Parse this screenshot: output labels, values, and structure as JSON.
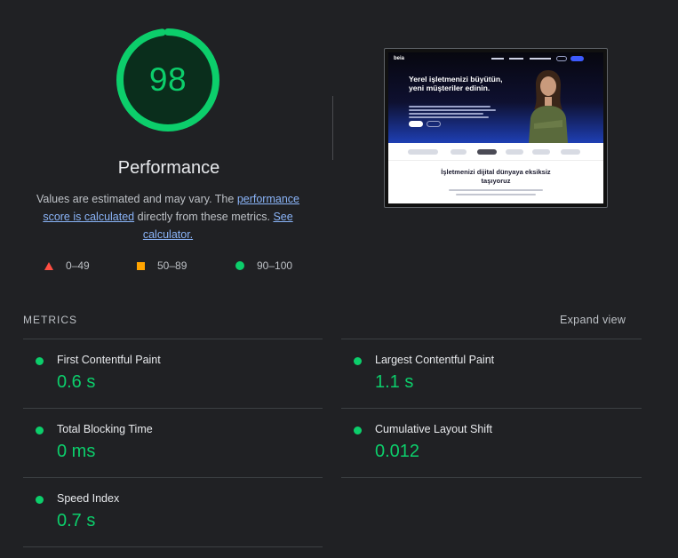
{
  "score": {
    "value": "98",
    "fraction": 0.98,
    "color": "#0cce6b"
  },
  "category_title": "Performance",
  "description": {
    "prefix": "Values are estimated and may vary. The ",
    "link1": "performance score is calculated",
    "middle": " directly from these metrics. ",
    "link2": "See calculator."
  },
  "legend": [
    {
      "icon": "fail-triangle-icon",
      "label": "0–49",
      "color": "#ff4e42"
    },
    {
      "icon": "average-square-icon",
      "label": "50–89",
      "color": "#ffa400"
    },
    {
      "icon": "pass-circle-icon",
      "label": "90–100",
      "color": "#0cce6b"
    }
  ],
  "screenshot": {
    "nav_logo": "beia",
    "hero_title": "Yerel işletmenizi büyütün, yeni müşteriler edinin.",
    "section_title": "İşletmenizi dijital dünyaya eksiksiz taşıyoruz"
  },
  "metrics": {
    "header": "METRICS",
    "expand_label": "Expand view",
    "items": [
      {
        "label": "First Contentful Paint",
        "value": "0.6 s"
      },
      {
        "label": "Largest Contentful Paint",
        "value": "1.1 s"
      },
      {
        "label": "Total Blocking Time",
        "value": "0 ms"
      },
      {
        "label": "Cumulative Layout Shift",
        "value": "0.012"
      },
      {
        "label": "Speed Index",
        "value": "0.7 s"
      }
    ]
  }
}
